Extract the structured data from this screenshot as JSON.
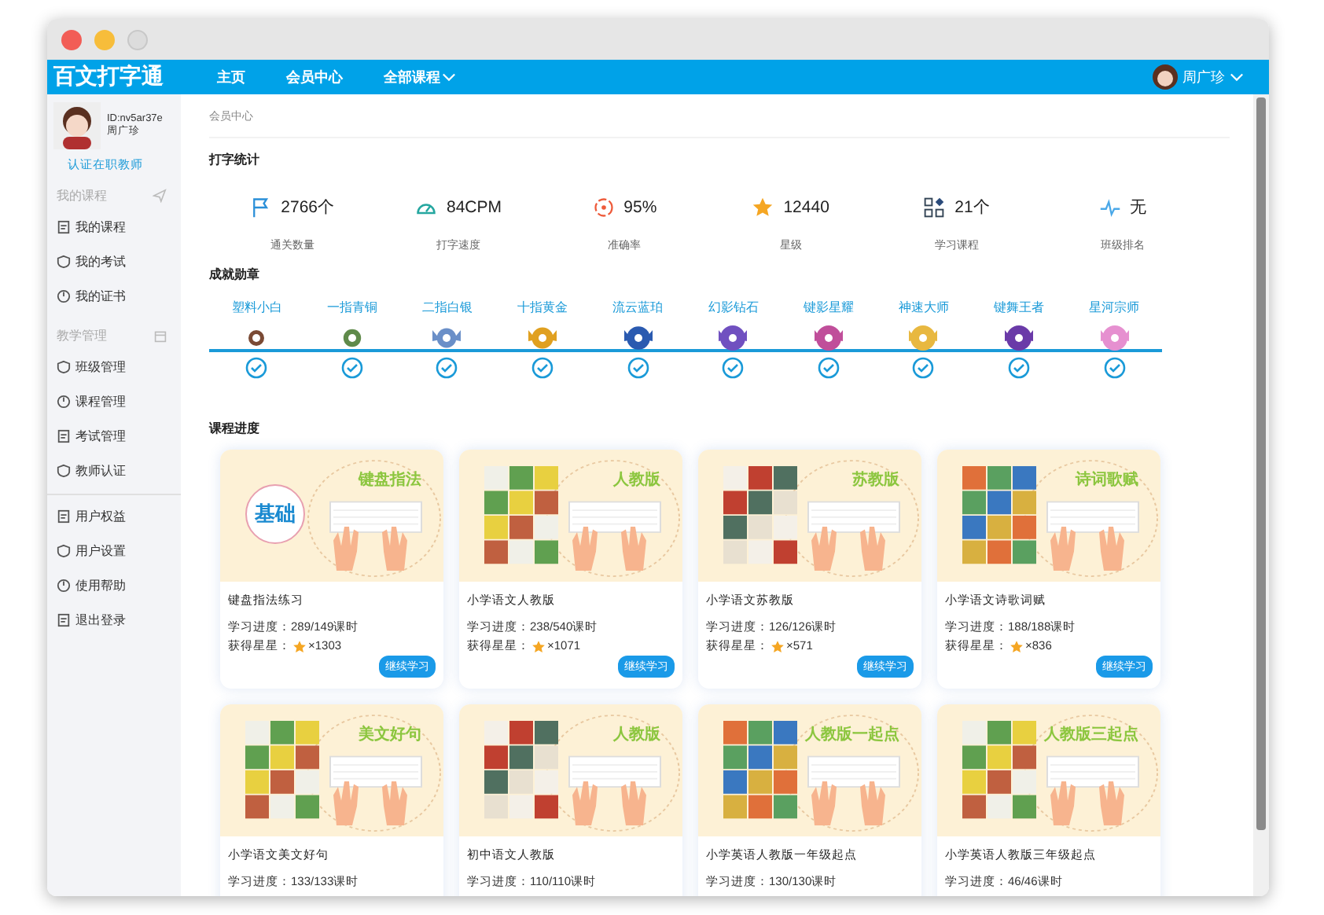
{
  "app": {
    "logo": "百文打字通"
  },
  "nav": [
    {
      "label": "主页"
    },
    {
      "label": "会员中心"
    },
    {
      "label": "全部课程",
      "dropdown": true
    }
  ],
  "user_menu": {
    "name": "周广珍"
  },
  "profile": {
    "id": "ID:nv5ar37e",
    "name": "周广珍",
    "link": "认证在职教师"
  },
  "sidebar": [
    {
      "kind": "heading",
      "label": "我的课程"
    },
    {
      "kind": "item",
      "label": "我的课程"
    },
    {
      "kind": "item",
      "label": "我的考试"
    },
    {
      "kind": "item",
      "label": "我的证书"
    },
    {
      "kind": "heading",
      "label": "教学管理"
    },
    {
      "kind": "item",
      "label": "班级管理"
    },
    {
      "kind": "item",
      "label": "课程管理"
    },
    {
      "kind": "item",
      "label": "考试管理"
    },
    {
      "kind": "item",
      "label": "教师认证"
    },
    {
      "kind": "divider"
    },
    {
      "kind": "item",
      "label": "用户权益"
    },
    {
      "kind": "item",
      "label": "用户设置"
    },
    {
      "kind": "item",
      "label": "使用帮助"
    },
    {
      "kind": "item",
      "label": "退出登录"
    }
  ],
  "breadcrumb": "会员中心",
  "stats": {
    "title": "打字统计",
    "items": [
      {
        "value": "2766个",
        "label": "通关数量"
      },
      {
        "value": "84CPM",
        "label": "打字速度"
      },
      {
        "value": "95%",
        "label": "准确率"
      },
      {
        "value": "12440",
        "label": "星级"
      },
      {
        "value": "21个",
        "label": "学习课程"
      },
      {
        "value": "无",
        "label": "班级排名"
      }
    ]
  },
  "badges": {
    "title": "成就勋章",
    "items": [
      {
        "label": "塑料小白",
        "color": "#7a4a35",
        "achieved": true
      },
      {
        "label": "一指青铜",
        "color": "#5f8a4a",
        "achieved": true
      },
      {
        "label": "二指白银",
        "color": "#6a8fc8",
        "achieved": true
      },
      {
        "label": "十指黄金",
        "color": "#e0a020",
        "achieved": true
      },
      {
        "label": "流云蓝珀",
        "color": "#2a5ab0",
        "achieved": true
      },
      {
        "label": "幻影钻石",
        "color": "#7050c0",
        "achieved": true
      },
      {
        "label": "键影星耀",
        "color": "#c04e9a",
        "achieved": true
      },
      {
        "label": "神速大师",
        "color": "#e8b840",
        "achieved": true
      },
      {
        "label": "键舞王者",
        "color": "#6a3aa8",
        "achieved": true
      },
      {
        "label": "星河宗师",
        "color": "#e690d0",
        "achieved": true
      }
    ]
  },
  "courses": {
    "title": "课程进度",
    "items": [
      {
        "kind": "badge",
        "badge": "基础",
        "tag": "键盘指法",
        "title": "键盘指法练习",
        "progress": "学习进度：289/149课时",
        "stars_label": "获得星星：",
        "stars_count": "×1303",
        "button": "继续学习"
      },
      {
        "kind": "picture",
        "tag": "人教版",
        "title": "小学语文人教版",
        "progress": "学习进度：238/540课时",
        "stars_label": "获得星星：",
        "stars_count": "×1071",
        "button": "继续学习"
      },
      {
        "kind": "picture",
        "tag": "苏教版",
        "title": "小学语文苏教版",
        "progress": "学习进度：126/126课时",
        "stars_label": "获得星星：",
        "stars_count": "×571",
        "button": "继续学习"
      },
      {
        "kind": "picture",
        "tag": "诗词歌赋",
        "title": "小学语文诗歌词赋",
        "progress": "学习进度：188/188课时",
        "stars_label": "获得星星：",
        "stars_count": "×836",
        "button": "继续学习"
      },
      {
        "kind": "picture",
        "tag": "美文好句",
        "title": "小学语文美文好句",
        "progress": "学习进度：133/133课时"
      },
      {
        "kind": "picture",
        "tag": "人教版",
        "title": "初中语文人教版",
        "progress": "学习进度：110/110课时"
      },
      {
        "kind": "picture",
        "tag": "人教版一起点",
        "title": "小学英语人教版一年级起点",
        "progress": "学习进度：130/130课时"
      },
      {
        "kind": "picture",
        "tag": "人教版三起点",
        "title": "小学英语人教版三年级起点",
        "progress": "学习进度：46/46课时"
      }
    ]
  }
}
